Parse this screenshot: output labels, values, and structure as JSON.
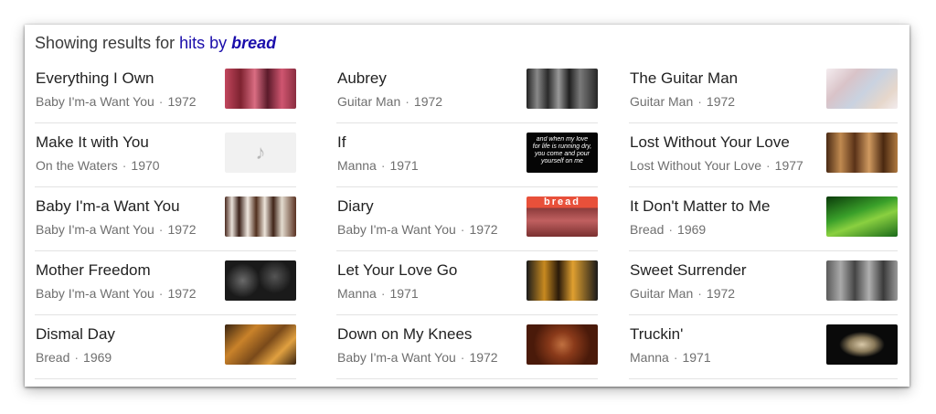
{
  "header": {
    "prefix": "Showing results for",
    "query_hits": "hits",
    "query_by": "by",
    "query_artist": "bread"
  },
  "columns": [
    [
      {
        "title": "Everything I Own",
        "album": "Baby I'm-a Want You",
        "year": "1972",
        "art": "art-red-band"
      },
      {
        "title": "Make It with You",
        "album": "On the Waters",
        "year": "1970",
        "art": "music-note-icon"
      },
      {
        "title": "Baby I'm-a Want You",
        "album": "Baby I'm-a Want You",
        "year": "1972",
        "art": "art-band-standing"
      },
      {
        "title": "Mother Freedom",
        "album": "Baby I'm-a Want You",
        "year": "1972",
        "art": "art-dark-band"
      },
      {
        "title": "Dismal Day",
        "album": "Bread",
        "year": "1969",
        "art": "art-bread-cover"
      }
    ],
    [
      {
        "title": "Aubrey",
        "album": "Guitar Man",
        "year": "1972",
        "art": "art-bw-band"
      },
      {
        "title": "If",
        "album": "Manna",
        "year": "1971",
        "art": "art-lyrics-black"
      },
      {
        "title": "Diary",
        "album": "Baby I'm-a Want You",
        "year": "1972",
        "art": "art-red-logo"
      },
      {
        "title": "Let Your Love Go",
        "album": "Manna",
        "year": "1971",
        "art": "art-stage-lights"
      },
      {
        "title": "Down on My Knees",
        "album": "Baby I'm-a Want You",
        "year": "1972",
        "art": "art-brown-frame"
      }
    ],
    [
      {
        "title": "The Guitar Man",
        "album": "Guitar Man",
        "year": "1972",
        "art": "art-faded-collage"
      },
      {
        "title": "Lost Without Your Love",
        "album": "Lost Without Your Love",
        "year": "1977",
        "art": "art-sepia-band"
      },
      {
        "title": "It Don't Matter to Me",
        "album": "Bread",
        "year": "1969",
        "art": "art-green-leaf"
      },
      {
        "title": "Sweet Surrender",
        "album": "Guitar Man",
        "year": "1972",
        "art": "art-gray-band"
      },
      {
        "title": "Truckin'",
        "album": "Manna",
        "year": "1971",
        "art": "art-black-emblem"
      }
    ]
  ],
  "thumb_texts": {
    "if_lyrics": "and when my love for life is running dry, you come and pour yourself on me",
    "diary_logo": "bread"
  },
  "colors": {
    "link": "#1a0dab",
    "title": "#222222",
    "meta": "#6f6f6f",
    "divider": "#e3e3e3"
  }
}
